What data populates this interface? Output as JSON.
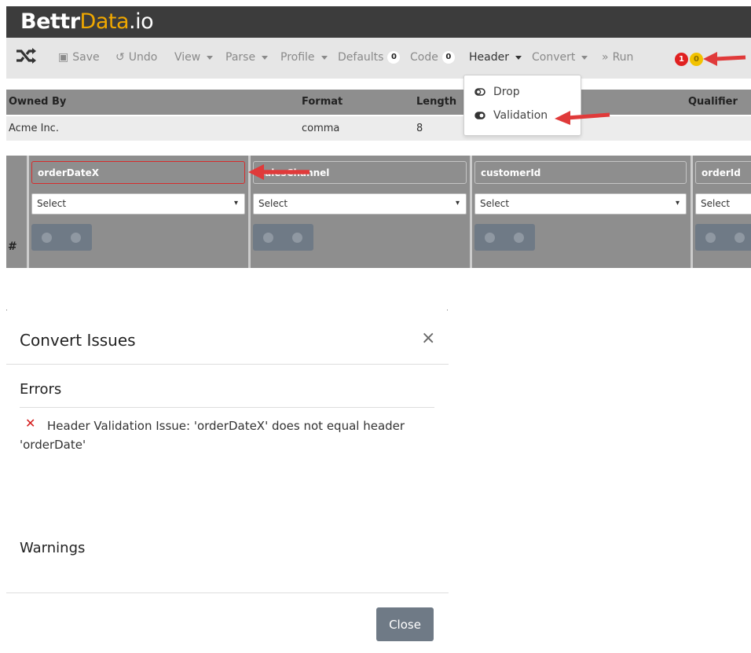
{
  "brand": {
    "part1": "Bettr",
    "part2": "Data",
    "part3": ".io"
  },
  "toolbar": {
    "save": "Save",
    "undo": "Undo",
    "view": "View",
    "parse": "Parse",
    "profile": "Profile",
    "defaults": "Defaults",
    "defaults_count": "0",
    "code": "Code",
    "code_count": "0",
    "header": "Header",
    "convert": "Convert",
    "run": "Run",
    "error_count": "1",
    "warning_count": "0"
  },
  "header_menu": {
    "items": [
      {
        "label": "Drop",
        "icon": "toggle-off-icon"
      },
      {
        "label": "Validation",
        "icon": "toggle-on-icon"
      }
    ]
  },
  "info_table": {
    "headers": {
      "owned_by": "Owned By",
      "format": "Format",
      "length": "Length",
      "qualifier": "Qualifier"
    },
    "row": {
      "owned_by": "Acme Inc.",
      "format": "comma",
      "length": "8"
    }
  },
  "grid": {
    "hash": "#",
    "columns": [
      {
        "header": "orderDateX",
        "select": "Select",
        "has_error": true
      },
      {
        "header": "salesChannel",
        "select": "Select",
        "has_error": false
      },
      {
        "header": "customerId",
        "select": "Select",
        "has_error": false
      },
      {
        "header": "orderId",
        "select": "Select",
        "has_error": false
      }
    ]
  },
  "dialog": {
    "title": "Convert Issues",
    "close_glyph": "×",
    "errors_heading": "Errors",
    "error_message": "Header Validation Issue: 'orderDateX' does not equal header 'orderDate'",
    "warnings_heading": "Warnings",
    "close_button": "Close"
  },
  "colors": {
    "annotation_arrow": "#e03a3a",
    "error_red": "#d41a1a",
    "brand_orange": "#f0a800"
  }
}
